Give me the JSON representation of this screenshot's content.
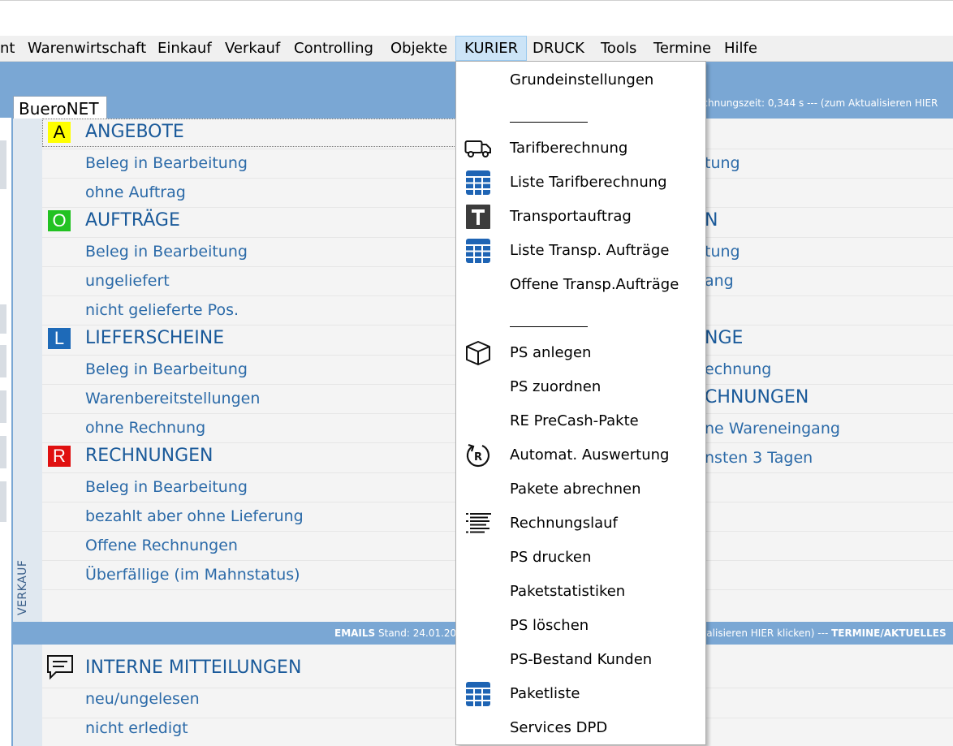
{
  "menubar": {
    "items": [
      "nt",
      "Warenwirtschaft",
      "Einkauf",
      "Verkauf",
      "Controlling",
      "Objekte",
      "KURIER",
      "DRUCK",
      "Tools",
      "Termine",
      "Hilfe"
    ],
    "active": "KURIER"
  },
  "tab": {
    "label": "BueroNET"
  },
  "info_top": "echnungszeit: 0,344 s --- (zum Aktualisieren HIER",
  "verkauf": {
    "side_label": "VERKAUF",
    "sections": [
      {
        "badge": "A",
        "badge_color": "#ffff00",
        "badge_text_color": "#000000",
        "title": "ANGEBOTE",
        "items": [
          "Beleg in Bearbeitung",
          "ohne Auftrag"
        ]
      },
      {
        "badge": "O",
        "badge_color": "#22c222",
        "badge_text_color": "#ffffff",
        "title": "AUFTRÄGE",
        "items": [
          "Beleg in Bearbeitung",
          "ungeliefert",
          "nicht gelieferte Pos."
        ]
      },
      {
        "badge": "L",
        "badge_color": "#1e6ab8",
        "badge_text_color": "#ffffff",
        "title": "LIEFERSCHEINE",
        "items": [
          "Beleg in Bearbeitung",
          "Warenbereitstellungen",
          "ohne Rechnung"
        ]
      },
      {
        "badge": "R",
        "badge_color": "#e01010",
        "badge_text_color": "#ffffff",
        "title": "RECHNUNGEN",
        "items": [
          "Beleg in Bearbeitung",
          "bezahlt aber ohne Lieferung",
          "Offene Rechnungen",
          "Überfällige (im Mahnstatus)"
        ]
      }
    ],
    "right_fragments": [
      "tung",
      "N",
      "tung",
      "ang",
      "NGE",
      "echnung",
      "CHNUNGEN",
      "ne Wareneingang",
      "nsten 3 Tagen"
    ]
  },
  "emails_bar": {
    "label_bold": "EMAILS",
    "label_rest": " Stand: 24.01.20",
    "right_text": "tualisieren HIER klicken) --- ",
    "right_bold": "TERMINE/AKTUELLES"
  },
  "mitteilungen": {
    "title": "INTERNE MITTEILUNGEN",
    "items": [
      "neu/ungelesen",
      "nicht erledigt"
    ]
  },
  "dropdown": {
    "items": [
      {
        "label": "Grundeinstellungen",
        "icon": ""
      },
      {
        "label": "___________",
        "icon": ""
      },
      {
        "label": "Tarifberechnung",
        "icon": "truck-icon"
      },
      {
        "label": "Liste Tarifberechnung",
        "icon": "table-icon"
      },
      {
        "label": "Transportauftrag",
        "icon": "t-icon"
      },
      {
        "label": "Liste Transp. Aufträge",
        "icon": "table-icon"
      },
      {
        "label": "Offene Transp.Aufträge",
        "icon": ""
      },
      {
        "label": "",
        "icon": ""
      },
      {
        "label": "___________",
        "icon": ""
      },
      {
        "label": "PS anlegen",
        "icon": "box-icon"
      },
      {
        "label": "PS zuordnen",
        "icon": ""
      },
      {
        "label": "RE PreCash-Pakte",
        "icon": ""
      },
      {
        "label": "Automat. Auswertung",
        "icon": "refresh-r-icon"
      },
      {
        "label": "Pakete abrechnen",
        "icon": ""
      },
      {
        "label": "Rechnungslauf",
        "icon": "list-icon"
      },
      {
        "label": "PS drucken",
        "icon": ""
      },
      {
        "label": "Paketstatistiken",
        "icon": ""
      },
      {
        "label": "PS löschen",
        "icon": ""
      },
      {
        "label": "PS-Bestand Kunden",
        "icon": ""
      },
      {
        "label": "Paketliste",
        "icon": "table-icon"
      },
      {
        "label": "Services DPD",
        "icon": ""
      }
    ]
  }
}
